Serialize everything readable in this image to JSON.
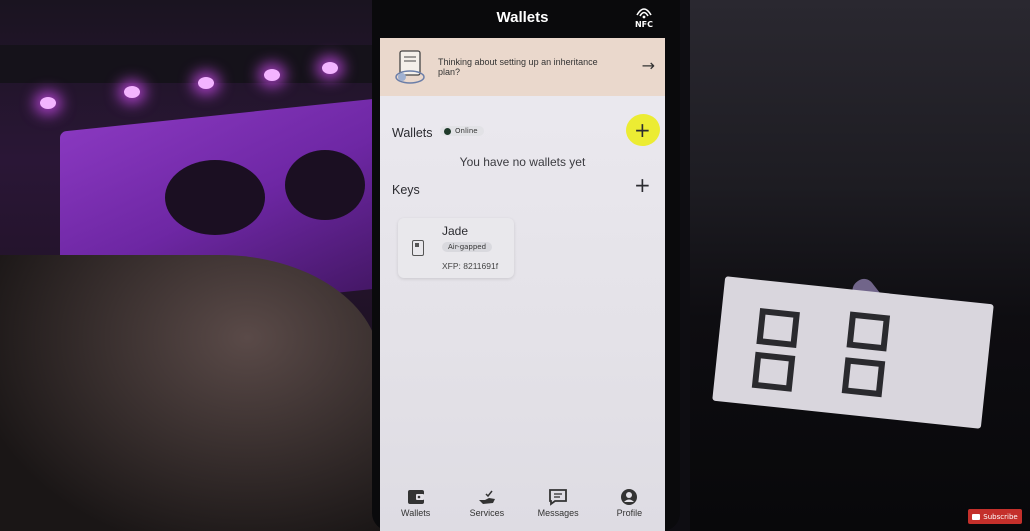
{
  "app": {
    "title": "Wallets",
    "nfc_label": "NFC"
  },
  "banner": {
    "text": "Thinking about setting up an inheritance plan?"
  },
  "wallets_section": {
    "heading": "Wallets",
    "status": "Online",
    "empty_message": "You have no wallets yet"
  },
  "keys_section": {
    "heading": "Keys",
    "keys": [
      {
        "name": "Jade",
        "badge": "Air-gapped",
        "xfp": "XFP: 8211691f"
      }
    ]
  },
  "tabbar": {
    "wallets": "Wallets",
    "services": "Services",
    "messages": "Messages",
    "profile": "Profile"
  },
  "youtube": {
    "subscribe": "Subscribe"
  },
  "colors": {
    "highlight": "#ecec1e",
    "banner": "#ead8cc",
    "online_dot": "#1f3a2a"
  }
}
